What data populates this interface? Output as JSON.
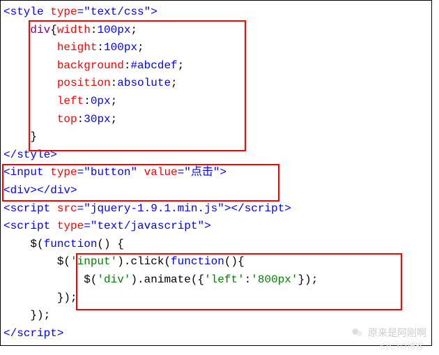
{
  "code": {
    "l1_open": "<style",
    "l1_attr": " type",
    "l1_eq": "=",
    "l1_val": "\"text/css\"",
    "l1_close": ">",
    "l2_sel": "    div",
    "l2_brace": "{",
    "l2_prop": "width",
    "l2_colon": ":",
    "l2_val": "100px",
    "l2_semi": ";",
    "l3_pad": "        ",
    "l3_prop": "height",
    "l3_val": "100px",
    "l4_prop": "background",
    "l4_val": "#abcdef",
    "l5_prop": "position",
    "l5_val": "absolute",
    "l6_prop": "left",
    "l6_val": "0px",
    "l7_prop": "top",
    "l7_val": "30px",
    "l8_brace": "    }",
    "l9": "</style>",
    "l10_open": "<input",
    "l10_a1": " type",
    "l10_v1": "\"button\"",
    "l10_a2": " value",
    "l10_v2": "\"点击\"",
    "l10_close": ">",
    "l11_open": "<div>",
    "l11_close": "</div>",
    "l12_open": "<script",
    "l12_attr": " src",
    "l12_val": "\"jquery-1.9.1.min.js\"",
    "l12_close": ">",
    "l12_end": "</script>",
    "l13_open": "<script",
    "l13_attr": " type",
    "l13_val": "\"text/javascript\"",
    "l13_close": ">",
    "l14_pad": "    $(",
    "l14_kw": "function",
    "l14_rest": "() {",
    "l15_pad": "        $(",
    "l15_str": "'input'",
    "l15_mid": ").click(",
    "l15_kw": "function",
    "l15_rest": "(){",
    "l16_pad": "            $(",
    "l16_str": "'div'",
    "l16_mid": ").animate({",
    "l16_str2": "'left'",
    "l16_colon": ":",
    "l16_str3": "'800px'",
    "l16_end": "});",
    "l17": "        });",
    "l18": "    });",
    "l19": "</script>"
  },
  "watermark": {
    "text1": "原来是阿刚啊",
    "text2": "51CTO博客"
  }
}
